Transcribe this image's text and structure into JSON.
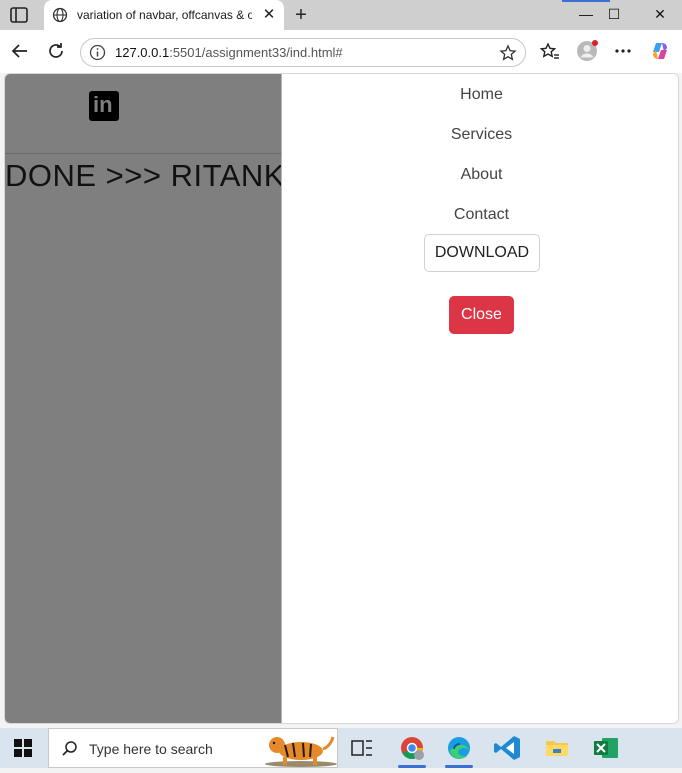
{
  "browser": {
    "tab_title": "variation of navbar, offcanvas & o",
    "address_host": "127.0.0.1",
    "address_rest": ":5501/assignment33/ind.html#"
  },
  "page": {
    "hero_text": "DONE >>> RITANK",
    "nav_items": [
      "Home",
      "Services",
      "About",
      "Contact"
    ],
    "download_label": "DOWNLOAD",
    "close_label": "Close",
    "colors": {
      "backdrop": "#7f7f7f",
      "close_button": "#dc3545"
    }
  },
  "taskbar": {
    "search_placeholder": "Type here to search"
  }
}
